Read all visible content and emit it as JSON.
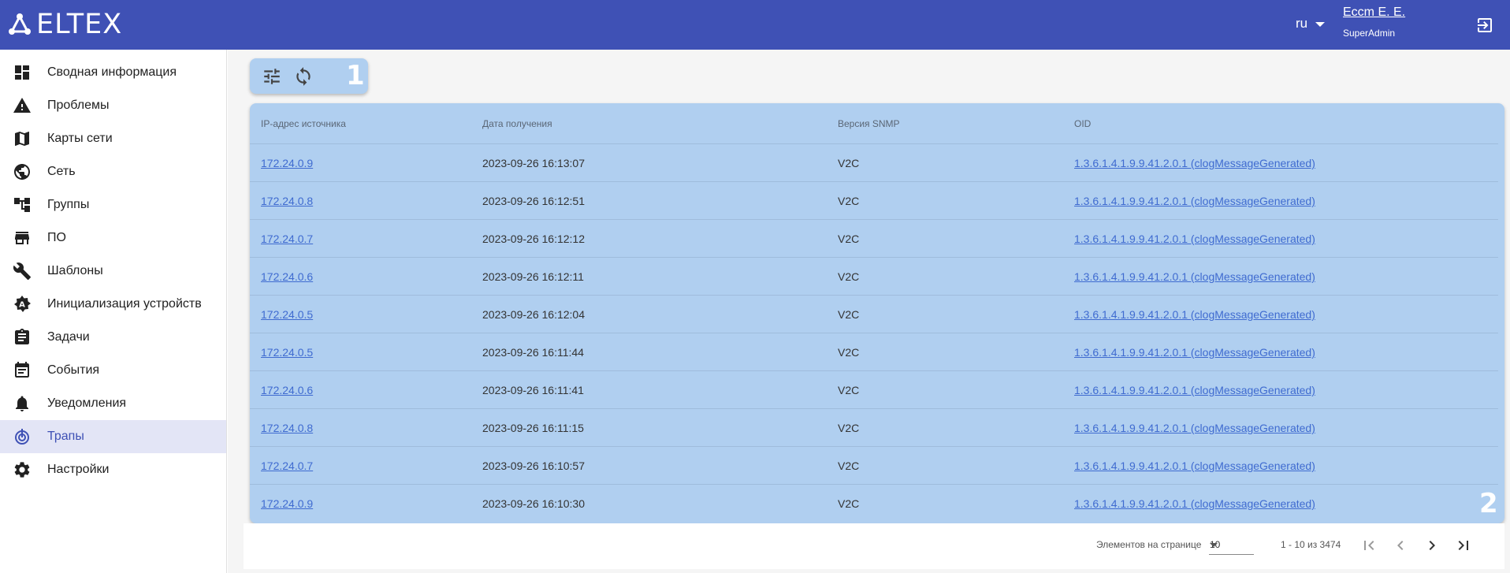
{
  "header": {
    "logo_text": "ELTEX",
    "lang": "ru",
    "user_name": "Eccm E. E.",
    "user_role": "SuperAdmin",
    "bg_color": "#3f51b5"
  },
  "sidebar": {
    "items": [
      {
        "label": "Сводная информация",
        "icon": "dashboard-icon"
      },
      {
        "label": "Проблемы",
        "icon": "warning-icon"
      },
      {
        "label": "Карты сети",
        "icon": "map-icon"
      },
      {
        "label": "Сеть",
        "icon": "globe-icon"
      },
      {
        "label": "Группы",
        "icon": "tree-icon"
      },
      {
        "label": "ПО",
        "icon": "store-icon"
      },
      {
        "label": "Шаблоны",
        "icon": "wrench-icon"
      },
      {
        "label": "Инициализация устройств",
        "icon": "auto-icon"
      },
      {
        "label": "Задачи",
        "icon": "clipboard-icon"
      },
      {
        "label": "События",
        "icon": "calendar-icon"
      },
      {
        "label": "Уведомления",
        "icon": "bell-icon"
      },
      {
        "label": "Трапы",
        "icon": "trap-icon",
        "active": true
      },
      {
        "label": "Настройки",
        "icon": "gear-icon"
      }
    ]
  },
  "toolbar": {
    "filter_icon": "tune-icon",
    "refresh_icon": "refresh-icon",
    "marker": "1"
  },
  "table": {
    "marker": "2",
    "columns": [
      "IP-адрес источника",
      "Дата получения",
      "Версия SNMP",
      "OID"
    ],
    "rows": [
      {
        "ip": "172.24.0.9",
        "date": "2023-09-26 16:13:07",
        "version": "V2C",
        "oid": "1.3.6.1.4.1.9.9.41.2.0.1 (clogMessageGenerated)"
      },
      {
        "ip": "172.24.0.8",
        "date": "2023-09-26 16:12:51",
        "version": "V2C",
        "oid": "1.3.6.1.4.1.9.9.41.2.0.1 (clogMessageGenerated)"
      },
      {
        "ip": "172.24.0.7",
        "date": "2023-09-26 16:12:12",
        "version": "V2C",
        "oid": "1.3.6.1.4.1.9.9.41.2.0.1 (clogMessageGenerated)"
      },
      {
        "ip": "172.24.0.6",
        "date": "2023-09-26 16:12:11",
        "version": "V2C",
        "oid": "1.3.6.1.4.1.9.9.41.2.0.1 (clogMessageGenerated)"
      },
      {
        "ip": "172.24.0.5",
        "date": "2023-09-26 16:12:04",
        "version": "V2C",
        "oid": "1.3.6.1.4.1.9.9.41.2.0.1 (clogMessageGenerated)"
      },
      {
        "ip": "172.24.0.5",
        "date": "2023-09-26 16:11:44",
        "version": "V2C",
        "oid": "1.3.6.1.4.1.9.9.41.2.0.1 (clogMessageGenerated)"
      },
      {
        "ip": "172.24.0.6",
        "date": "2023-09-26 16:11:41",
        "version": "V2C",
        "oid": "1.3.6.1.4.1.9.9.41.2.0.1 (clogMessageGenerated)"
      },
      {
        "ip": "172.24.0.8",
        "date": "2023-09-26 16:11:15",
        "version": "V2C",
        "oid": "1.3.6.1.4.1.9.9.41.2.0.1 (clogMessageGenerated)"
      },
      {
        "ip": "172.24.0.7",
        "date": "2023-09-26 16:10:57",
        "version": "V2C",
        "oid": "1.3.6.1.4.1.9.9.41.2.0.1 (clogMessageGenerated)"
      },
      {
        "ip": "172.24.0.9",
        "date": "2023-09-26 16:10:30",
        "version": "V2C",
        "oid": "1.3.6.1.4.1.9.9.41.2.0.1 (clogMessageGenerated)"
      }
    ]
  },
  "paginator": {
    "page_size_label": "Элементов на странице",
    "page_size": "10",
    "range": "1 - 10 из 3474"
  }
}
